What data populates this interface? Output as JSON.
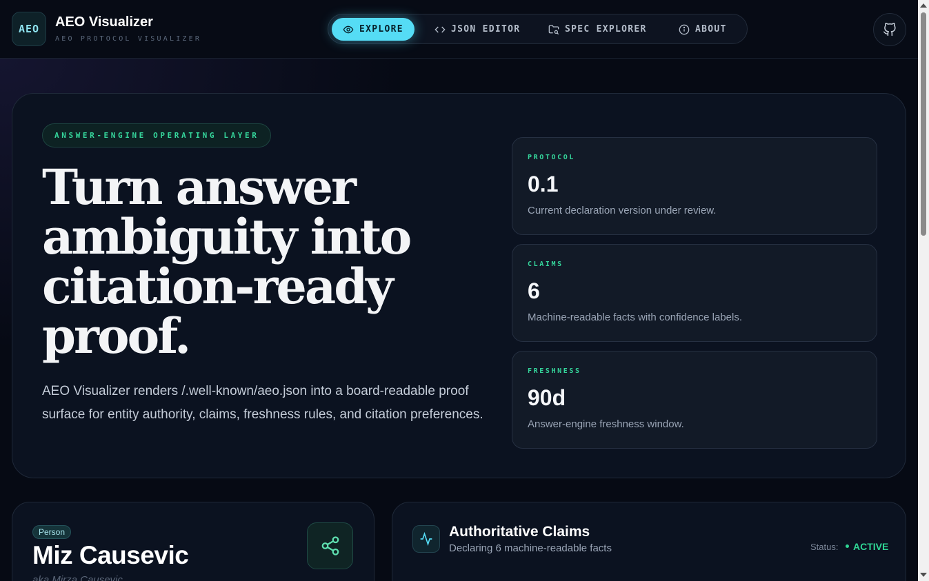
{
  "header": {
    "logo_text": "AEO",
    "title": "AEO Visualizer",
    "subtitle": "AEO PROTOCOL VISUALIZER",
    "nav": [
      {
        "label": "EXPLORE",
        "icon": "eye-icon",
        "active": true
      },
      {
        "label": "JSON EDITOR",
        "icon": "code-icon",
        "active": false
      },
      {
        "label": "SPEC EXPLORER",
        "icon": "folder-search-icon",
        "active": false
      },
      {
        "label": "ABOUT",
        "icon": "info-icon",
        "active": false
      }
    ],
    "github_icon": "github-icon"
  },
  "hero": {
    "eyebrow": "ANSWER-ENGINE OPERATING LAYER",
    "headline": "Turn answer ambiguity into citation-ready proof.",
    "lead": "AEO Visualizer renders /.well-known/aeo.json into a board-readable proof surface for entity authority, claims, freshness rules, and citation preferences.",
    "stats": [
      {
        "label": "PROTOCOL",
        "value": "0.1",
        "desc": "Current declaration version under review."
      },
      {
        "label": "CLAIMS",
        "value": "6",
        "desc": "Machine-readable facts with confidence labels."
      },
      {
        "label": "FRESHNESS",
        "value": "90d",
        "desc": "Answer-engine freshness window."
      }
    ]
  },
  "entity": {
    "type_badge": "Person",
    "name": "Miz Causevic",
    "aka": "aka Mirza Causevic",
    "share_icon": "share-icon"
  },
  "claims": {
    "icon": "activity-icon",
    "title": "Authoritative Claims",
    "subtitle": "Declaring 6 machine-readable facts",
    "status_label": "Status:",
    "status_value": "ACTIVE"
  },
  "colors": {
    "accent": "#55dcf5",
    "success": "#35d59b",
    "background": "#060a14",
    "card": "#0b1220"
  }
}
